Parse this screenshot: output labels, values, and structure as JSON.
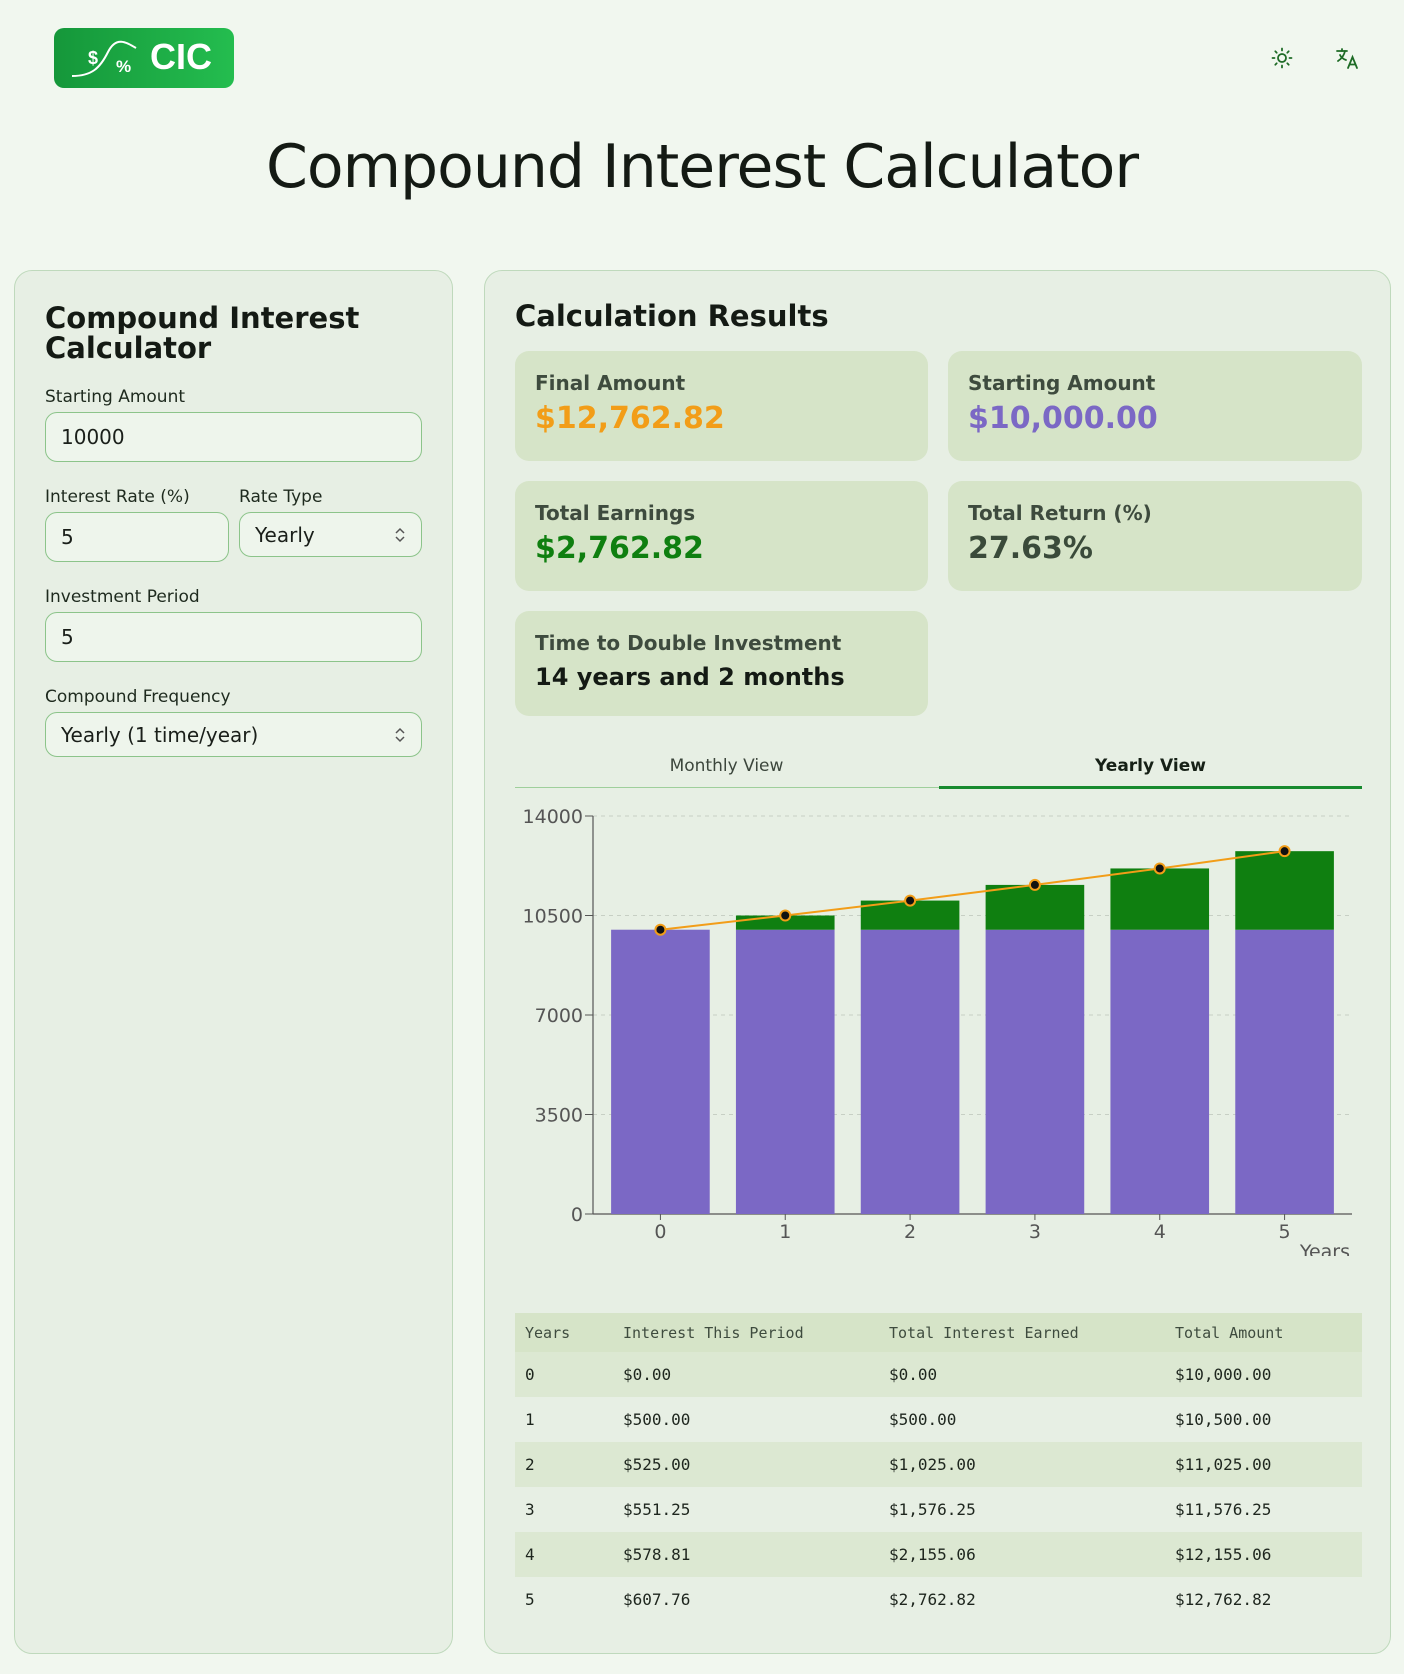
{
  "header": {
    "logo_text": "CIC",
    "logo_symbols": {
      "dollar": "$",
      "percent": "%"
    },
    "theme_icon": "sun-icon",
    "language_icon": "translate-icon",
    "page_title": "Compound Interest Calculator"
  },
  "form": {
    "title": "Compound Interest Calculator",
    "starting_amount_label": "Starting Amount",
    "starting_amount_value": "10000",
    "interest_rate_label": "Interest Rate (%)",
    "interest_rate_value": "5",
    "rate_type_label": "Rate Type",
    "rate_type_value": "Yearly",
    "period_label": "Investment Period",
    "period_value": "5",
    "frequency_label": "Compound Frequency",
    "frequency_value": "Yearly (1 time/year)"
  },
  "results": {
    "title": "Calculation Results",
    "final_amount_label": "Final Amount",
    "final_amount_value": "$12,762.82",
    "starting_amount_label": "Starting Amount",
    "starting_amount_value": "$10,000.00",
    "total_earnings_label": "Total Earnings",
    "total_earnings_value": "$2,762.82",
    "total_return_label": "Total Return (%)",
    "total_return_value": "27.63%",
    "double_label": "Time to Double Investment",
    "double_value": "14 years and 2 months",
    "colors": {
      "final": "#f29d18",
      "starting": "#7b68c5",
      "earnings": "#0f7f10",
      "return": "#3a4a3a"
    }
  },
  "tabs": {
    "monthly": "Monthly View",
    "yearly": "Yearly View",
    "active": "yearly"
  },
  "chart_data": {
    "type": "bar",
    "stacked": true,
    "categories": [
      "0",
      "1",
      "2",
      "3",
      "4",
      "5"
    ],
    "xlabel": "Years",
    "ylim": [
      0,
      14000
    ],
    "yticks": [
      "0",
      "3500",
      "7000",
      "10500",
      "14000"
    ],
    "grid": true,
    "legend": "bottom",
    "series": [
      {
        "name": "Starting Amount",
        "kind": "bar",
        "color": "#7b68c5",
        "values": [
          10000,
          10000,
          10000,
          10000,
          10000,
          10000
        ]
      },
      {
        "name": "Total Interest Earned",
        "kind": "bar",
        "color": "#0f7f10",
        "values": [
          0,
          500,
          1025,
          1576.25,
          2155.06,
          2762.82
        ]
      },
      {
        "name": "Total Amount",
        "kind": "line",
        "color": "#f29d18",
        "values": [
          10000,
          10500,
          11025,
          11576.25,
          12155.06,
          12762.82
        ]
      }
    ]
  },
  "table": {
    "headers": [
      "Years",
      "Interest This Period",
      "Total Interest Earned",
      "Total Amount"
    ],
    "rows": [
      [
        "0",
        "$0.00",
        "$0.00",
        "$10,000.00"
      ],
      [
        "1",
        "$500.00",
        "$500.00",
        "$10,500.00"
      ],
      [
        "2",
        "$525.00",
        "$1,025.00",
        "$11,025.00"
      ],
      [
        "3",
        "$551.25",
        "$1,576.25",
        "$11,576.25"
      ],
      [
        "4",
        "$578.81",
        "$2,155.06",
        "$12,155.06"
      ],
      [
        "5",
        "$607.76",
        "$2,762.82",
        "$12,762.82"
      ]
    ]
  }
}
